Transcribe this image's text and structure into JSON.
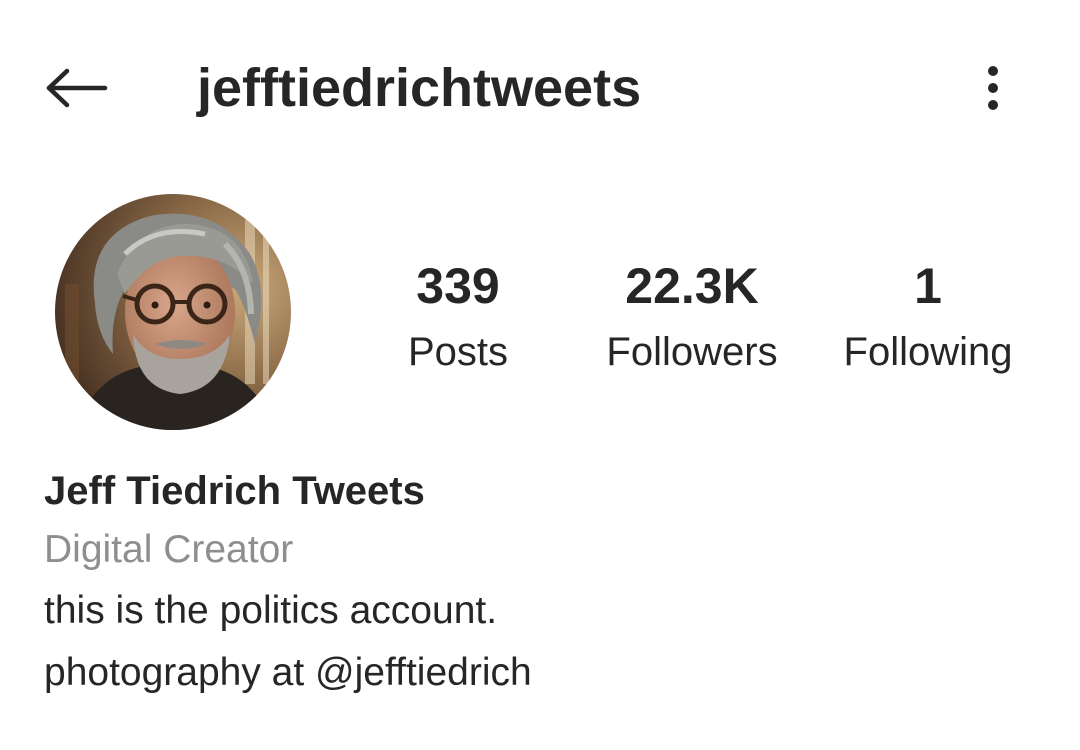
{
  "header": {
    "username": "jefftiedrichtweets",
    "back_icon": "arrow-left-icon",
    "menu_icon": "more-vertical-icon"
  },
  "profile": {
    "avatar_icon": "profile-photo",
    "stats": [
      {
        "value": "339",
        "label": "Posts"
      },
      {
        "value": "22.3K",
        "label": "Followers"
      },
      {
        "value": "1",
        "label": "Following"
      }
    ],
    "display_name": "Jeff Tiedrich Tweets",
    "category": "Digital Creator",
    "bio_line1": "this is the politics account.",
    "bio_line2_prefix": "photography at ",
    "bio_line2_mention": "@jefftiedrich"
  },
  "colors": {
    "text": "#262626",
    "secondary": "#8e8e8e",
    "background": "#ffffff"
  }
}
